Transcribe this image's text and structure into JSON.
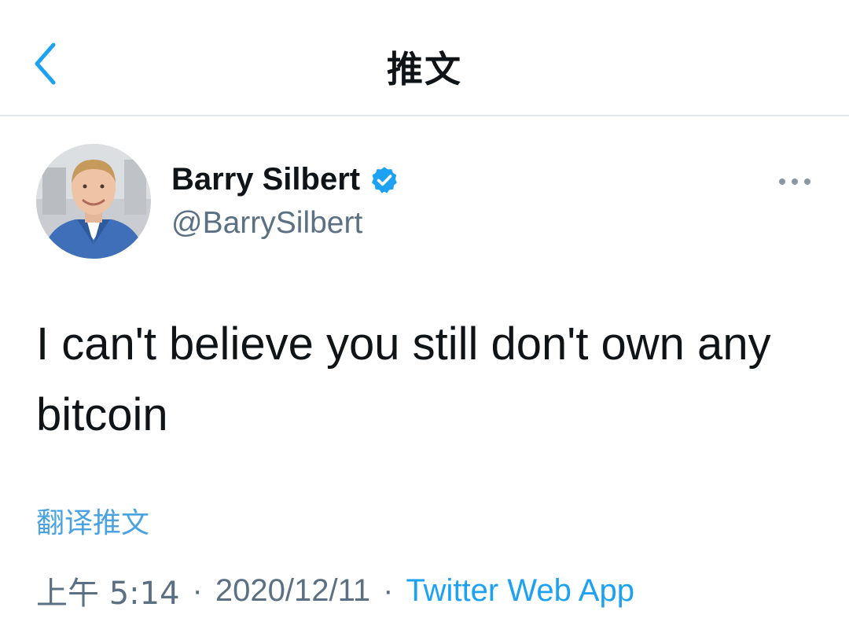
{
  "header": {
    "title": "推文",
    "back_icon": "chevron-left-icon"
  },
  "tweet": {
    "author_name": "Barry Silbert",
    "author_handle": "@BarrySilbert",
    "verified_icon": "verified-badge-icon",
    "more_icon": "more-horizontal-icon",
    "text": "I can't believe you still don't own any bitcoin",
    "translate_label": "翻译推文",
    "time": "上午 5:14",
    "separator": "·",
    "date": "2020/12/11",
    "source": "Twitter Web App"
  },
  "colors": {
    "accent": "#1da1f2",
    "secondary_text": "#5b7083",
    "divider": "#e1e8ed"
  }
}
